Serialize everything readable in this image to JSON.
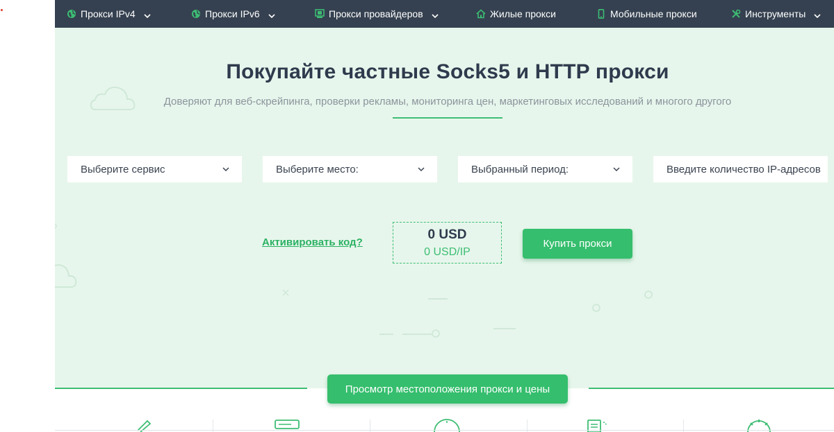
{
  "nav": {
    "items": [
      {
        "label": "Прокси IPv4",
        "icon": "globe-icon",
        "has_dropdown": true
      },
      {
        "label": "Прокси IPv6",
        "icon": "globe-icon",
        "has_dropdown": true
      },
      {
        "label": "Прокси провайдеров",
        "icon": "provider-monitor-icon",
        "has_dropdown": true
      },
      {
        "label": "Жилые прокси",
        "icon": "home-icon",
        "has_dropdown": false
      },
      {
        "label": "Мобильные прокси",
        "icon": "mobile-phone-icon",
        "has_dropdown": false
      },
      {
        "label": "Инструменты",
        "icon": "tools-icon",
        "has_dropdown": true
      }
    ]
  },
  "hero": {
    "title": "Покупайте частные Socks5 и HTTP прокси",
    "subtitle": "Доверяют для веб-скрейпинга, проверки рекламы, мониторинга цен, маркетинговых исследований и многого другого"
  },
  "form": {
    "service_select": "Выберите сервис",
    "location_select": "Выберите место:",
    "period_select": "Выбранный период:",
    "ip_count_placeholder": "Введите количество IP-адресов"
  },
  "price": {
    "total": "0 USD",
    "per_ip": "0 USD/IP"
  },
  "actions": {
    "activate_code": "Активировать код?",
    "buy": "Купить прокси",
    "view_locations": "Просмотр местоположения прокси и цены"
  },
  "colors": {
    "nav_bg": "#354150",
    "accent": "#35be6d",
    "hero_bg": "#e7f6ec",
    "title": "#2f3a4d"
  }
}
